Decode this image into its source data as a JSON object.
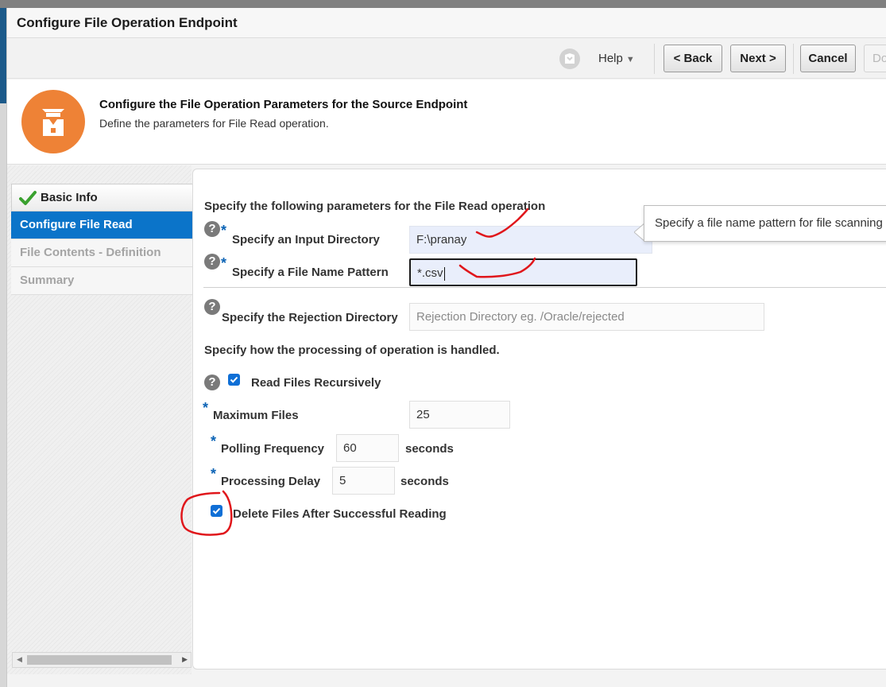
{
  "dialog": {
    "title": "Configure File Operation Endpoint"
  },
  "toolbar": {
    "help_label": "Help",
    "back_label": "< Back",
    "next_label": "Next >",
    "cancel_label": "Cancel",
    "done_label": "Do"
  },
  "header": {
    "title": "Configure the File Operation Parameters for the Source Endpoint",
    "subtitle": "Define the parameters for File Read operation.",
    "icon": "adapter-icon",
    "icon_color": "#ee8236"
  },
  "train": {
    "items": [
      {
        "label": "Basic Info",
        "state": "visited"
      },
      {
        "label": "Configure File Read",
        "state": "current"
      },
      {
        "label": "File Contents - Definition",
        "state": "disabled"
      },
      {
        "label": "Summary",
        "state": "disabled"
      }
    ],
    "accent": "#0b74c9"
  },
  "form": {
    "section_heading": "Specify the following parameters for the File Read operation",
    "input_directory": {
      "label": "Specify an Input Directory",
      "value": "F:\\pranay",
      "required_marker": "*"
    },
    "file_name_pattern": {
      "label": "Specify a File Name Pattern",
      "value": "*.csv",
      "required_marker": "*"
    },
    "rejection_directory": {
      "label": "Specify the Rejection Directory",
      "value": "",
      "placeholder": "Rejection Directory eg. /Oracle/rejected"
    },
    "processing_heading": "Specify how the processing of operation is handled.",
    "read_recursively": {
      "label": "Read Files Recursively",
      "checked": true
    },
    "maximum_files": {
      "label": "Maximum Files",
      "value": "25",
      "required_marker": "*"
    },
    "polling_frequency": {
      "label": "Polling Frequency",
      "value": "60",
      "unit": "seconds",
      "required_marker": "*"
    },
    "processing_delay": {
      "label": "Processing Delay",
      "value": "5",
      "unit": "seconds",
      "required_marker": "*"
    },
    "delete_after_read": {
      "label": "Delete Files After Successful Reading",
      "checked": true
    }
  },
  "tooltip": {
    "text": "Specify a file name pattern for file scanning"
  },
  "annotation_color": "#e0161b"
}
